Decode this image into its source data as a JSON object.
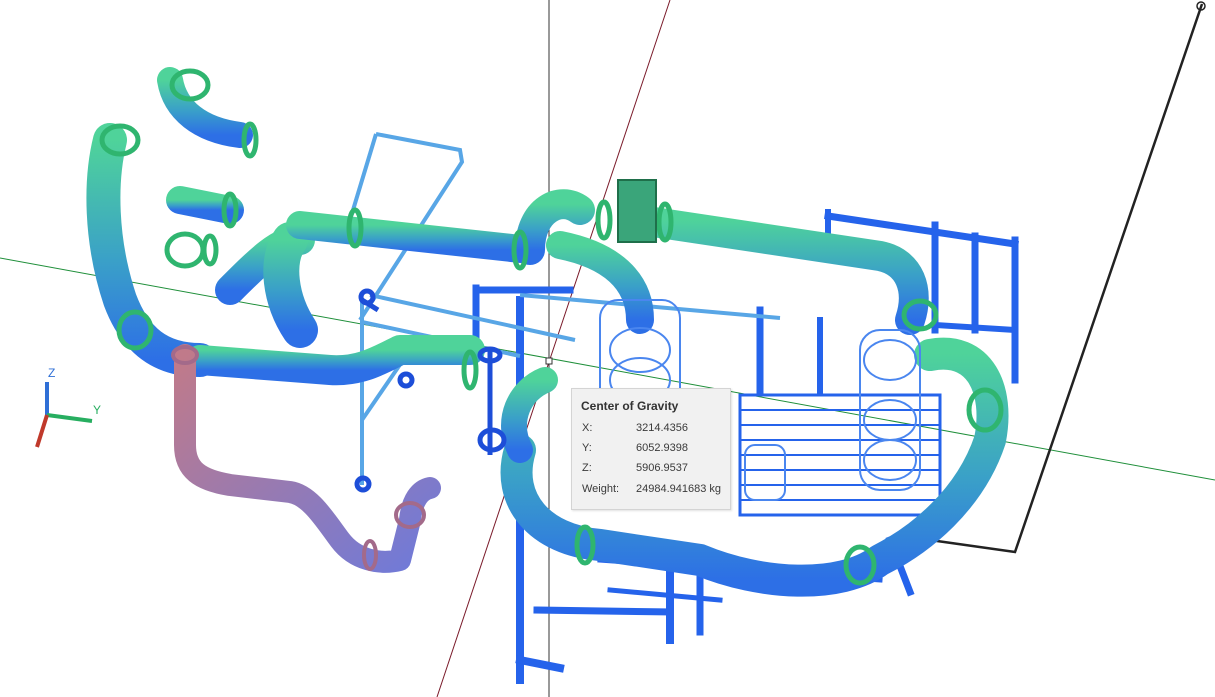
{
  "viewport": {
    "ucs_icon": {
      "z_label": "Z",
      "y_label": "Y",
      "x_color": "#c0392b",
      "y_color": "#27ae60",
      "z_color": "#2f6fd6"
    },
    "colors": {
      "pipe_green": "#37b37f",
      "pipe_blue": "#2f6de8",
      "pipe_purple": "#9b7ab8",
      "structure_blue": "#2563eb",
      "tooltip_bg": "#f1f1f1",
      "green_axis": "#1f8f3a",
      "red_axis": "#7a1a2a"
    }
  },
  "tooltip": {
    "title": "Center of Gravity",
    "x_label": "X:",
    "x_value": "3214.4356",
    "y_label": "Y:",
    "y_value": "6052.9398",
    "z_label": "Z:",
    "z_value": "5906.9537",
    "weight_label": "Weight:",
    "weight_value": "24984.941683 kg"
  }
}
